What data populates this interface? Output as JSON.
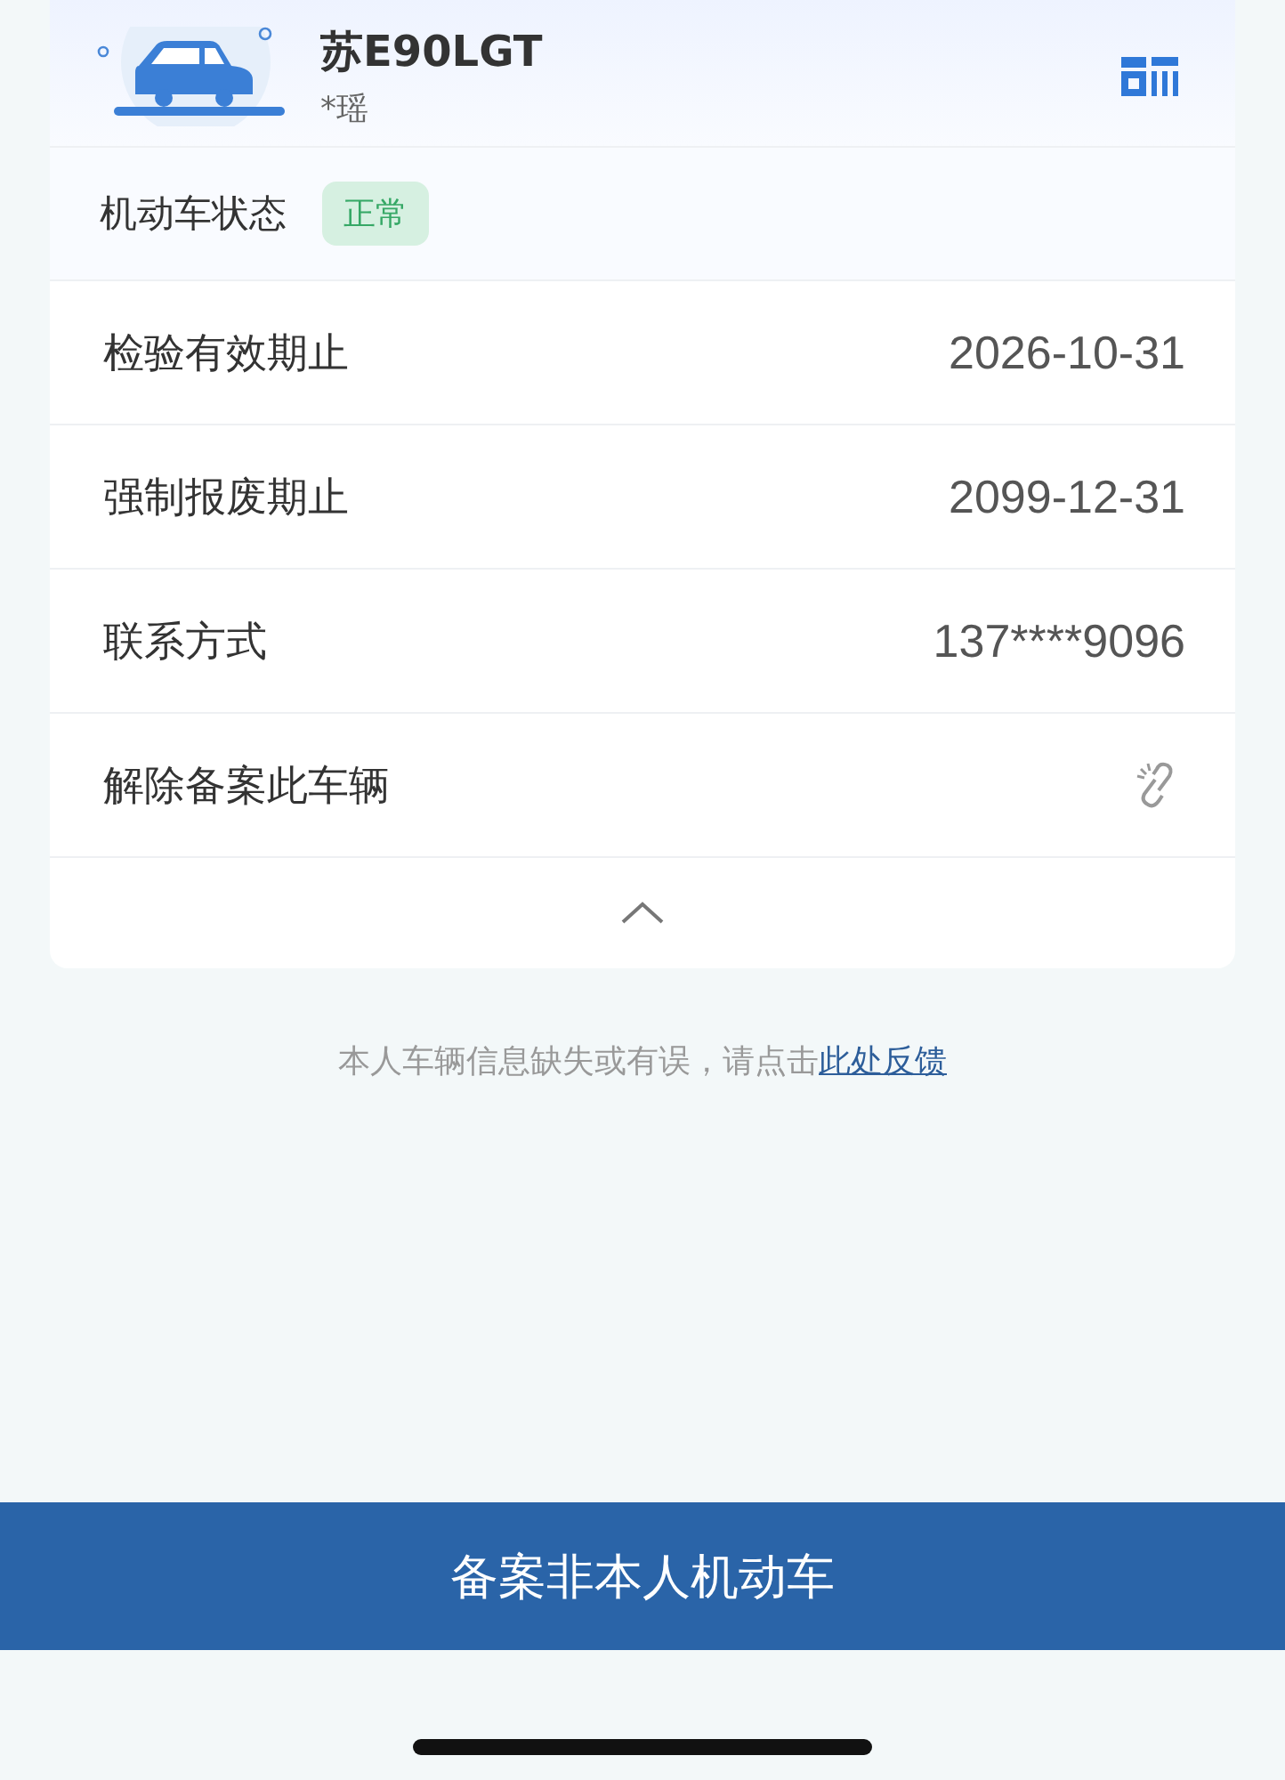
{
  "vehicle": {
    "plate": "苏E90LGT",
    "owner": "*瑶"
  },
  "status": {
    "label": "机动车状态",
    "badge": "正常"
  },
  "rows": [
    {
      "kind": "text",
      "label": "检验有效期止",
      "value": "2026-10-31"
    },
    {
      "kind": "text",
      "label": "强制报废期止",
      "value": "2099-12-31"
    },
    {
      "kind": "text",
      "label": "联系方式",
      "value": "137****9096"
    },
    {
      "kind": "unlink",
      "label": "解除备案此车辆"
    }
  ],
  "collapse": {
    "expanded": true
  },
  "feedback": {
    "text": "本人车辆信息缺失或有误，请点击",
    "link": "此处反馈"
  },
  "primary_button": "备案非本人机动车"
}
